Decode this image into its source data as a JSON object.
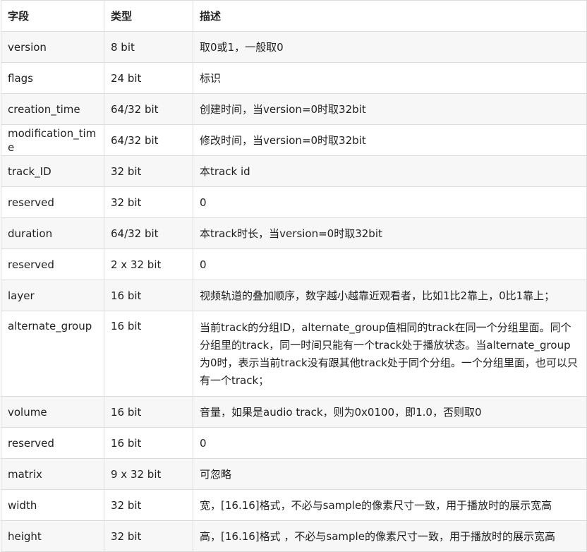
{
  "headers": {
    "field": "字段",
    "type": "类型",
    "description": "描述"
  },
  "rows": [
    {
      "field": "version",
      "type": "8 bit",
      "description": "取0或1，一般取0"
    },
    {
      "field": "flags",
      "type": "24 bit",
      "description": "标识"
    },
    {
      "field": "creation_time",
      "type": "64/32 bit",
      "description": "创建时间，当version=0时取32bit"
    },
    {
      "field": "modification_time",
      "type": "64/32 bit",
      "description": "修改时间，当version=0时取32bit"
    },
    {
      "field": "track_ID",
      "type": "32 bit",
      "description": "本track id"
    },
    {
      "field": "reserved",
      "type": "32 bit",
      "description": "0"
    },
    {
      "field": "duration",
      "type": "64/32 bit",
      "description": "本track时长，当version=0时取32bit"
    },
    {
      "field": "reserved",
      "type": "2 x 32 bit",
      "description": "0"
    },
    {
      "field": "layer",
      "type": "16 bit",
      "description": "视频轨道的叠加顺序，数字越小越靠近观看者，比如1比2靠上，0比1靠上；"
    },
    {
      "field": "alternate_group",
      "type": "16 bit",
      "description": "当前track的分组ID，alternate_group值相同的track在同一个分组里面。同个分组里的track，同一时间只能有一个track处于播放状态。当alternate_group为0时，表示当前track没有跟其他track处于同个分组。一个分组里面，也可以只有一个track；"
    },
    {
      "field": "volume",
      "type": "16 bit",
      "description": "音量，如果是audio track，则为0x0100，即1.0，否则取0"
    },
    {
      "field": "reserved",
      "type": "16 bit",
      "description": "0"
    },
    {
      "field": "matrix",
      "type": "9 x 32 bit",
      "description": "可忽略"
    },
    {
      "field": "width",
      "type": "32 bit",
      "description": "宽，[16.16]格式，不必与sample的像素尺寸一致，用于播放时的展示宽高"
    },
    {
      "field": "height",
      "type": "32 bit",
      "description": "高，[16.16]格式 ，不必与sample的像素尺寸一致，用于播放时的展示宽高"
    }
  ]
}
